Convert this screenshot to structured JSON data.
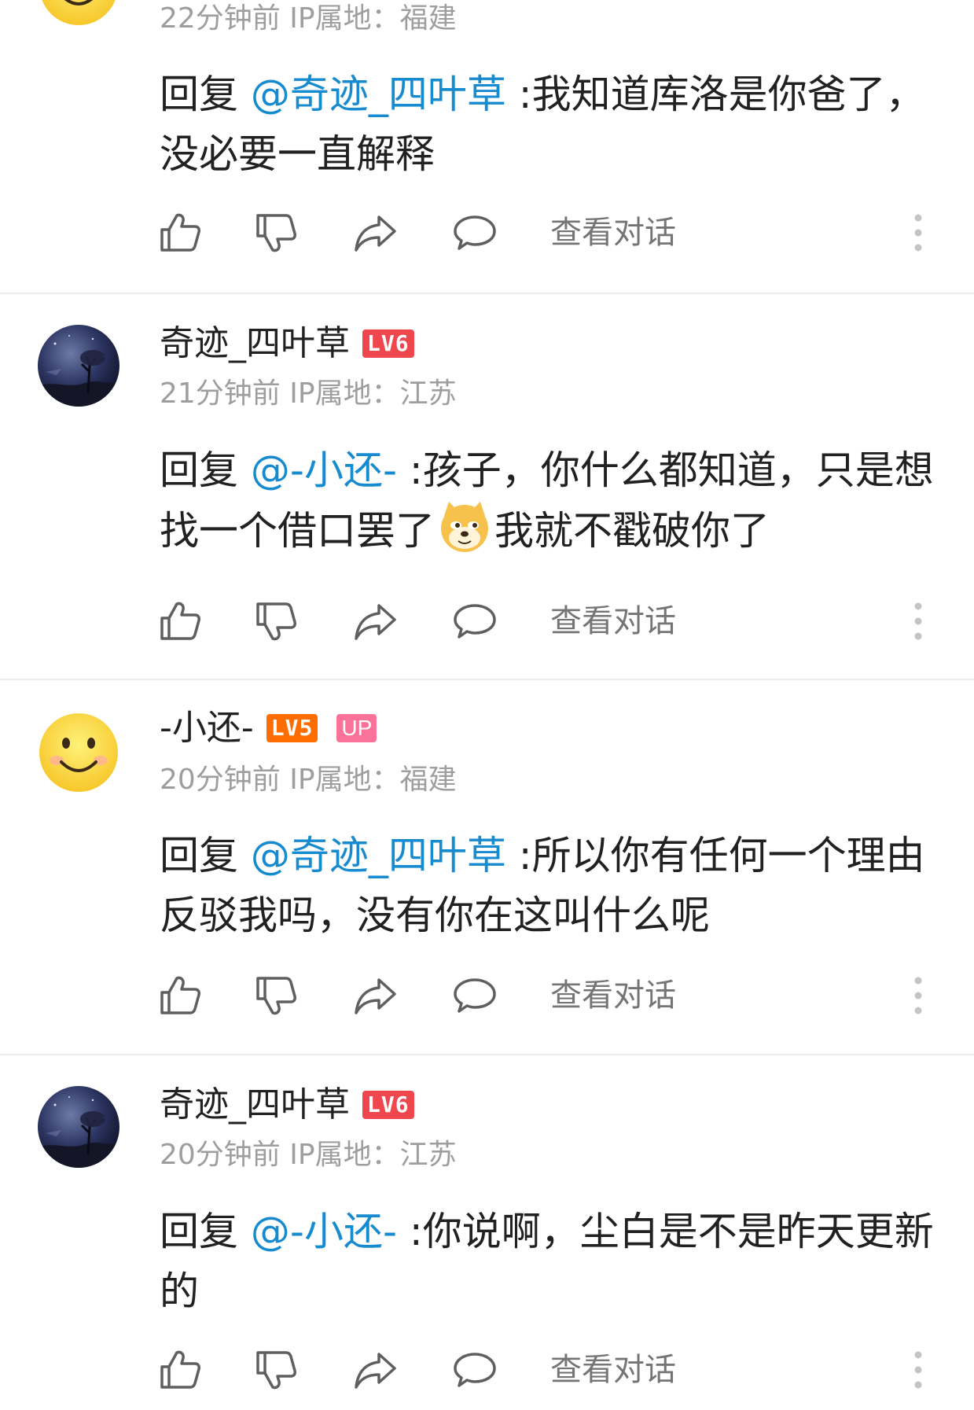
{
  "comments": [
    {
      "username": "",
      "level": "",
      "meta": "22分钟前 IP属地：福建",
      "reply_prefix": "回复",
      "mention": "@奇迹_四叶草",
      "text": " :我知道库洛是你爸了，没必要一直解释",
      "text_after_emoji": "",
      "view_conversation": "查看对话"
    },
    {
      "username": "奇迹_四叶草",
      "level": "LV6",
      "meta": "21分钟前 IP属地：江苏",
      "reply_prefix": "回复",
      "mention": "@-小还-",
      "text": " :孩子，你什么都知道，只是想找一个借口罢了",
      "text_after_emoji": "我就不戳破你了",
      "emoji": "doge-emoji",
      "view_conversation": "查看对话"
    },
    {
      "username": "-小还-",
      "level": "LV5",
      "badge": "UP",
      "meta": "20分钟前 IP属地：福建",
      "reply_prefix": "回复",
      "mention": "@奇迹_四叶草",
      "text": " :所以你有任何一个理由反驳我吗，没有你在这叫什么呢",
      "text_after_emoji": "",
      "view_conversation": "查看对话"
    },
    {
      "username": "奇迹_四叶草",
      "level": "LV6",
      "meta": "20分钟前 IP属地：江苏",
      "reply_prefix": "回复",
      "mention": "@-小还-",
      "text": " :你说啊，尘白是不是昨天更新的",
      "text_after_emoji": "",
      "view_conversation": "查看对话"
    }
  ],
  "icons": {
    "like": "thumbs-up-icon",
    "dislike": "thumbs-down-icon",
    "share": "share-icon",
    "reply": "comment-bubble-icon",
    "more": "more-vertical-icon"
  },
  "colors": {
    "mention": "#178bcf",
    "lv6": "#f0464e",
    "lv5": "#ff6c00",
    "up": "#fb7299",
    "meta": "#9e9e9e",
    "icon": "#757575"
  }
}
